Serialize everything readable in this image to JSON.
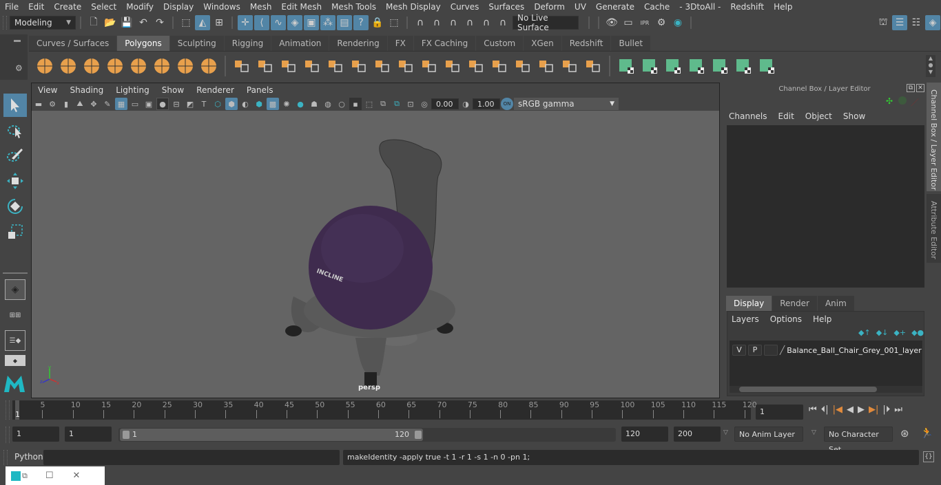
{
  "menubar": [
    "File",
    "Edit",
    "Create",
    "Select",
    "Modify",
    "Display",
    "Windows",
    "Mesh",
    "Edit Mesh",
    "Mesh Tools",
    "Mesh Display",
    "Curves",
    "Surfaces",
    "Deform",
    "UV",
    "Generate",
    "Cache",
    "- 3DtoAll -",
    "Redshift",
    "Help"
  ],
  "statusline": {
    "workspace": "Modeling",
    "live_surface": "No Live Surface"
  },
  "shelf": {
    "tabs": [
      "Curves / Surfaces",
      "Polygons",
      "Sculpting",
      "Rigging",
      "Animation",
      "Rendering",
      "FX",
      "FX Caching",
      "Custom",
      "XGen",
      "Redshift",
      "Bullet"
    ],
    "active_tab": "Polygons",
    "icons": [
      "poly-sphere-icon",
      "poly-cube-icon",
      "poly-cylinder-icon",
      "poly-cone-icon",
      "poly-plane-icon",
      "poly-torus-icon",
      "poly-pyramid-icon",
      "poly-pipe-icon",
      "combine-icon",
      "separate-icon",
      "extract-icon",
      "smooth-icon",
      "cleanup-icon",
      "bevel-icon",
      "bridge-icon",
      "multi-cut-icon",
      "extrude-icon",
      "insert-edge-loop-icon",
      "offset-edge-loop-icon",
      "bevel-edge-icon",
      "append-polygon-icon",
      "merge-icon",
      "fill-hole-icon",
      "mirror-icon",
      "uv-planar-icon",
      "uv-cylindrical-icon",
      "uv-spherical-icon",
      "uv-auto-icon",
      "uv-unfold-icon",
      "uv-editor-icon",
      "uv-layout-icon"
    ]
  },
  "viewport": {
    "menu": [
      "View",
      "Shading",
      "Lighting",
      "Show",
      "Renderer",
      "Panels"
    ],
    "exposure": "0.00",
    "gamma": "1.00",
    "color_space": "sRGB gamma",
    "camera_label": "persp",
    "model_text": "INCLINE",
    "axis": {
      "x": "x",
      "y": "y",
      "z": "z"
    }
  },
  "channel_box": {
    "title": "Channel Box / Layer Editor",
    "menu": [
      "Channels",
      "Edit",
      "Object",
      "Show"
    ]
  },
  "layer_editor": {
    "tabs": [
      "Display",
      "Render",
      "Anim"
    ],
    "active_tab": "Display",
    "menu": [
      "Layers",
      "Options",
      "Help"
    ],
    "layers": [
      {
        "v": "V",
        "p": "P",
        "name": "Balance_Ball_Chair_Grey_001_layer"
      }
    ]
  },
  "side_tabs": [
    "Channel Box / Layer Editor",
    "Attribute Editor"
  ],
  "timeline": {
    "ticks": [
      5,
      10,
      15,
      20,
      25,
      30,
      35,
      40,
      45,
      50,
      55,
      60,
      65,
      70,
      75,
      80,
      85,
      90,
      95,
      100,
      105,
      110,
      115,
      120
    ],
    "current_frame_marker": "1",
    "current_frame": "1",
    "start": 1,
    "end": 120
  },
  "range": {
    "start_time": "1",
    "playback_start": "1",
    "slider_start": "1",
    "slider_end": "120",
    "playback_end": "120",
    "end_time": "200",
    "anim_layer": "No Anim Layer",
    "character_set": "No Character Set"
  },
  "command": {
    "language": "Python",
    "input": "",
    "result": "makeIdentity -apply true -t 1 -r 1 -s 1 -n 0 -pn 1;"
  }
}
